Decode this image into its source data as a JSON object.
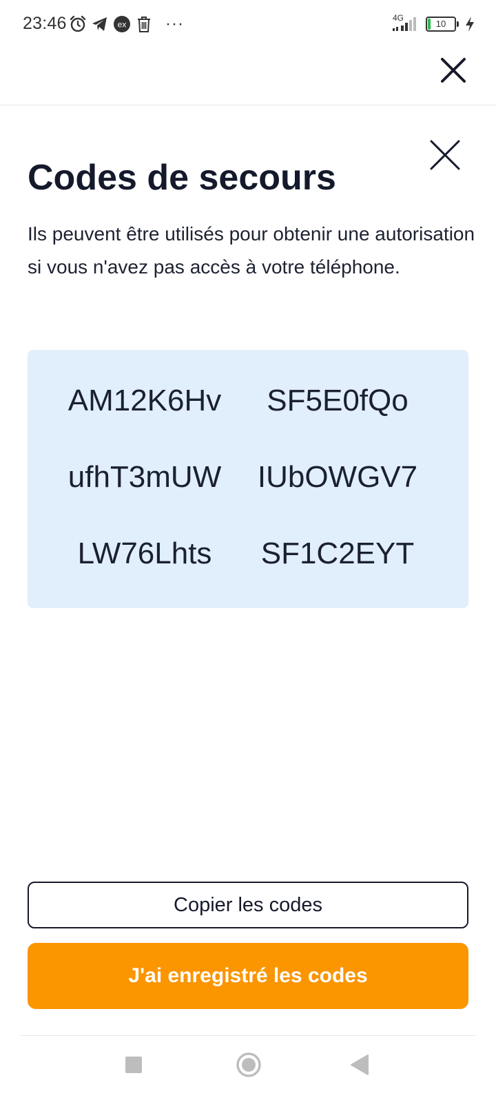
{
  "status_bar": {
    "time": "23:46",
    "left_icons": [
      "alarm-icon",
      "telegram-icon",
      "ex-icon",
      "trash-icon",
      "more-dots-icon"
    ],
    "ex_label": "ex",
    "more_label": "···",
    "network_label": "4G",
    "battery_level": "10",
    "charging": true
  },
  "sheet": {
    "title": "Codes de secours",
    "description": "Ils peuvent être utilisés pour obtenir une autorisation si vous n'avez pas accès à votre téléphone.",
    "codes": [
      "AM12K6Hv",
      "SF5E0fQo",
      "ufhT3mUW",
      "IUbOWGV7",
      "LW76Lhts",
      "SF1C2EYT"
    ],
    "codes_bg_color": "#e1eefc"
  },
  "buttons": {
    "copy_label": "Copier les codes",
    "saved_label": "J'ai enregistré les codes",
    "saved_color": "#fb9500"
  },
  "nav_bar": {
    "icons": [
      "recents-square-icon",
      "home-circle-icon",
      "back-triangle-icon"
    ]
  }
}
